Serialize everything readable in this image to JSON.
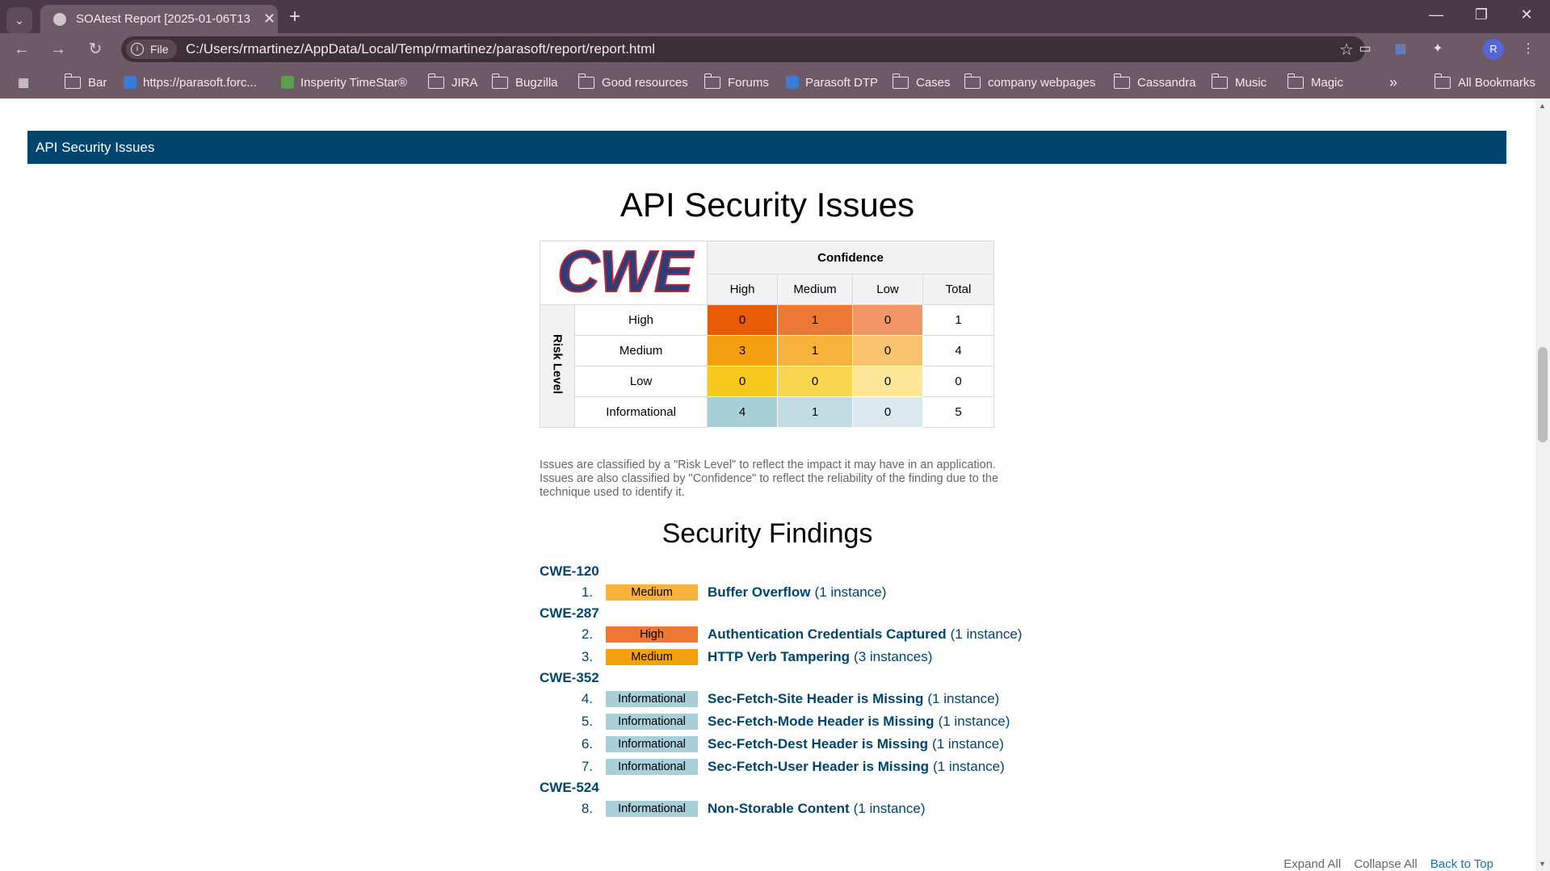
{
  "browser": {
    "tab_title": "SOAtest Report [2025-01-06T13",
    "file_chip": "File",
    "url": "C:/Users/rmartinez/AppData/Local/Temp/rmartinez/parasoft/report/report.html",
    "profile_initial": "R",
    "bookmarks": [
      {
        "label": "Bar",
        "icon": "folder-icon"
      },
      {
        "label": "https://parasoft.forc...",
        "icon": "salesforce-icon"
      },
      {
        "label": "Insperity TimeStar®",
        "icon": "timestar-icon"
      },
      {
        "label": "JIRA",
        "icon": "folder-icon"
      },
      {
        "label": "Bugzilla",
        "icon": "folder-icon"
      },
      {
        "label": "Good resources",
        "icon": "folder-icon"
      },
      {
        "label": "Forums",
        "icon": "folder-icon"
      },
      {
        "label": "Parasoft DTP",
        "icon": "dtp-icon"
      },
      {
        "label": "Cases",
        "icon": "folder-icon"
      },
      {
        "label": "company webpages",
        "icon": "folder-icon"
      },
      {
        "label": "Cassandra",
        "icon": "folder-icon"
      },
      {
        "label": "Music",
        "icon": "folder-icon"
      },
      {
        "label": "Magic",
        "icon": "folder-icon"
      }
    ],
    "all_bookmarks": "All Bookmarks",
    "overflow": "»"
  },
  "section_bar": "API Security Issues",
  "heading": "API Security Issues",
  "matrix": {
    "logo_text": "CWE",
    "confidence_label": "Confidence",
    "risk_label": "Risk Level",
    "columns": [
      "High",
      "Medium",
      "Low",
      "Total"
    ],
    "rows": [
      {
        "label": "High",
        "values": [
          "0",
          "1",
          "0",
          "1"
        ],
        "colors": [
          "#e85d04",
          "#ec7834",
          "#f29668"
        ]
      },
      {
        "label": "Medium",
        "values": [
          "3",
          "1",
          "0",
          "4"
        ],
        "colors": [
          "#f5a00f",
          "#f6b23a",
          "#f8c36e"
        ]
      },
      {
        "label": "Low",
        "values": [
          "0",
          "0",
          "0",
          "0"
        ],
        "colors": [
          "#f7c81e",
          "#f9d650",
          "#fce697"
        ]
      },
      {
        "label": "Informational",
        "values": [
          "4",
          "1",
          "0",
          "5"
        ],
        "colors": [
          "#a9cfd8",
          "#c2dce3",
          "#d9e9ee"
        ]
      }
    ]
  },
  "note": "Issues are classified by a \"Risk Level\" to reflect the impact it may have in an application. Issues are also classified by \"Confidence\" to reflect the reliability of the finding due to the technique used to identify it.",
  "findings_heading": "Security Findings",
  "findings": [
    {
      "cwe": "CWE-120",
      "items": [
        {
          "num": "1.",
          "level": "Medium",
          "color": "#f6b23a",
          "title": "Buffer Overflow",
          "count": "(1 instance)"
        }
      ]
    },
    {
      "cwe": "CWE-287",
      "items": [
        {
          "num": "2.",
          "level": "High",
          "color": "#ec7834",
          "title": "Authentication Credentials Captured",
          "count": "(1 instance)"
        },
        {
          "num": "3.",
          "level": "Medium",
          "color": "#f5a00f",
          "title": "HTTP Verb Tampering",
          "count": "(3 instances)"
        }
      ]
    },
    {
      "cwe": "CWE-352",
      "items": [
        {
          "num": "4.",
          "level": "Informational",
          "color": "#a9cfd8",
          "title": "Sec-Fetch-Site Header is Missing",
          "count": "(1 instance)"
        },
        {
          "num": "5.",
          "level": "Informational",
          "color": "#a9cfd8",
          "title": "Sec-Fetch-Mode Header is Missing",
          "count": "(1 instance)"
        },
        {
          "num": "6.",
          "level": "Informational",
          "color": "#a9cfd8",
          "title": "Sec-Fetch-Dest Header is Missing",
          "count": "(1 instance)"
        },
        {
          "num": "7.",
          "level": "Informational",
          "color": "#a9cfd8",
          "title": "Sec-Fetch-User Header is Missing",
          "count": "(1 instance)"
        }
      ]
    },
    {
      "cwe": "CWE-524",
      "items": [
        {
          "num": "8.",
          "level": "Informational",
          "color": "#a9cfd8",
          "title": "Non-Storable Content",
          "count": "(1 instance)"
        }
      ]
    }
  ],
  "footer_links": {
    "expand": "Expand All",
    "collapse": "Collapse All",
    "top": "Back to Top"
  }
}
